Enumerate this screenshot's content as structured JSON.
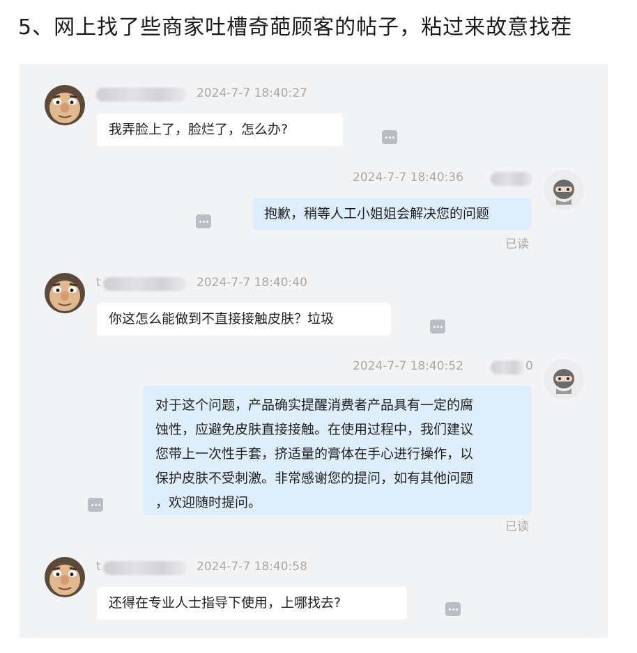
{
  "headline": "5、网上找了些商家吐槽奇葩顾客的帖子，粘过来故意找茬",
  "messages": [
    {
      "side": "left",
      "time": "2024-7-7 18:40:27",
      "text": "我弄脸上了，脸烂了，怎么办?"
    },
    {
      "side": "right",
      "time": "2024-7-7 18:40:36",
      "text": "抱歉，稍等人工小姐姐会解决您的问题",
      "status": "已读"
    },
    {
      "side": "left",
      "name_prefix": "t",
      "time": "2024-7-7 18:40:40",
      "text": "你这怎么能做到不直接接触皮肤？垃圾"
    },
    {
      "side": "right",
      "name_suffix": "0",
      "time": "2024-7-7 18:40:52",
      "lines": [
        "对于这个问题，产品确实提醒消费者产品具有一定的腐",
        "蚀性，应避免皮肤直接接触。在使用过程中，我们建议",
        "您带上一次性手套，挤适量的膏体在手心进行操作，以",
        "保护皮肤不受刺激。非常感谢您的提问，如有其他问题",
        "，欢迎随时提问。"
      ],
      "status": "已读"
    },
    {
      "side": "left",
      "name_prefix": "t",
      "time": "2024-7-7 18:40:58",
      "text": "还得在专业人士指导下使用，上哪找去?"
    }
  ],
  "icons": {
    "more": "more-options-icon",
    "customer_avatar": "cartoon-face-avatar",
    "agent_avatar": "ninja-avatar"
  },
  "colors": {
    "chat_bg": "#f2f3f5",
    "left_bubble": "#ffffff",
    "right_bubble": "#dfeefd",
    "meta": "#a9a9a9"
  }
}
